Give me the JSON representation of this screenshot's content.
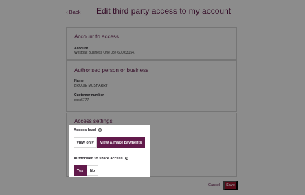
{
  "header": {
    "back_label": "Back",
    "title": "Edit third party access to my account"
  },
  "account_section": {
    "title": "Account to access",
    "account_label": "Account",
    "account_value": "Westpac Business One 037-600 631547"
  },
  "person_section": {
    "title": "Authorised person or business",
    "name_label": "Name",
    "name_value": "BRODIE MCSHARRY",
    "customer_label": "Customer number",
    "customer_value": "xxxx6777"
  },
  "settings_section": {
    "title": "Access settings",
    "access_level_label": "Access level",
    "access_options": [
      "View only",
      "View & make payments"
    ],
    "access_selected": "View & make payments",
    "share_label": "Authorised to share access",
    "share_options": [
      "Yes",
      "No"
    ],
    "share_selected": "Yes"
  },
  "footer": {
    "cancel_label": "Cancel",
    "save_label": "Save"
  },
  "colors": {
    "brand": "#621a4b",
    "save": "#a3162f"
  },
  "icons": {
    "back": "chevron-left-icon",
    "help": "help-circle-icon"
  }
}
